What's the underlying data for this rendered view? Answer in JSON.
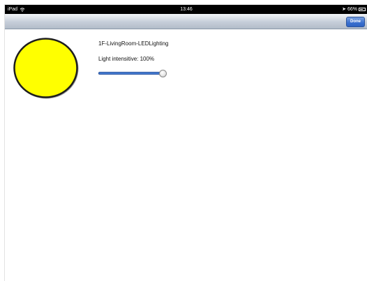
{
  "status_bar": {
    "device": "iPad",
    "wifi_icon": "wifi-icon",
    "time": "13:46",
    "location_icon": "location-arrow-icon",
    "battery": "66%",
    "battery_level": 0.66
  },
  "nav_bar": {
    "done_label": "Done"
  },
  "light": {
    "icon": "lightbulb-icon",
    "icon_color": "#ffff00",
    "name": "1F-LivingRoom-LEDLighting",
    "intensity_label": "Light intensitive: 100%",
    "intensity_value": 1.0
  },
  "colors": {
    "accent": "#3a6fcf",
    "status_bar": "#000000"
  }
}
